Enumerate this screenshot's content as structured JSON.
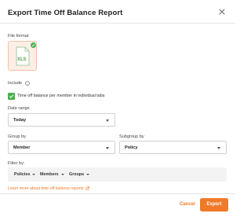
{
  "dialog": {
    "title": "Export Time Off Balance Report"
  },
  "file_format": {
    "label": "File format",
    "selected": "XLS",
    "accent_color": "#f07a2a",
    "check_color": "#4caf50"
  },
  "include": {
    "label": "Include",
    "option_label": "Time off balance per member in individual tabs",
    "checked": true
  },
  "date_range": {
    "label": "Date range",
    "value": "Today"
  },
  "group_by": {
    "label": "Group by",
    "value": "Member"
  },
  "subgroup_by": {
    "label": "Subgroup by",
    "value": "Policy"
  },
  "filter": {
    "label": "Filter by:",
    "chips": [
      {
        "label": "Policies"
      },
      {
        "label": "Members"
      },
      {
        "label": "Groups"
      }
    ]
  },
  "learn_more": {
    "text": "Learn more about time off balance reports"
  },
  "footer": {
    "cancel_label": "Cancel",
    "export_label": "Export",
    "primary_color": "#f07a2a"
  }
}
